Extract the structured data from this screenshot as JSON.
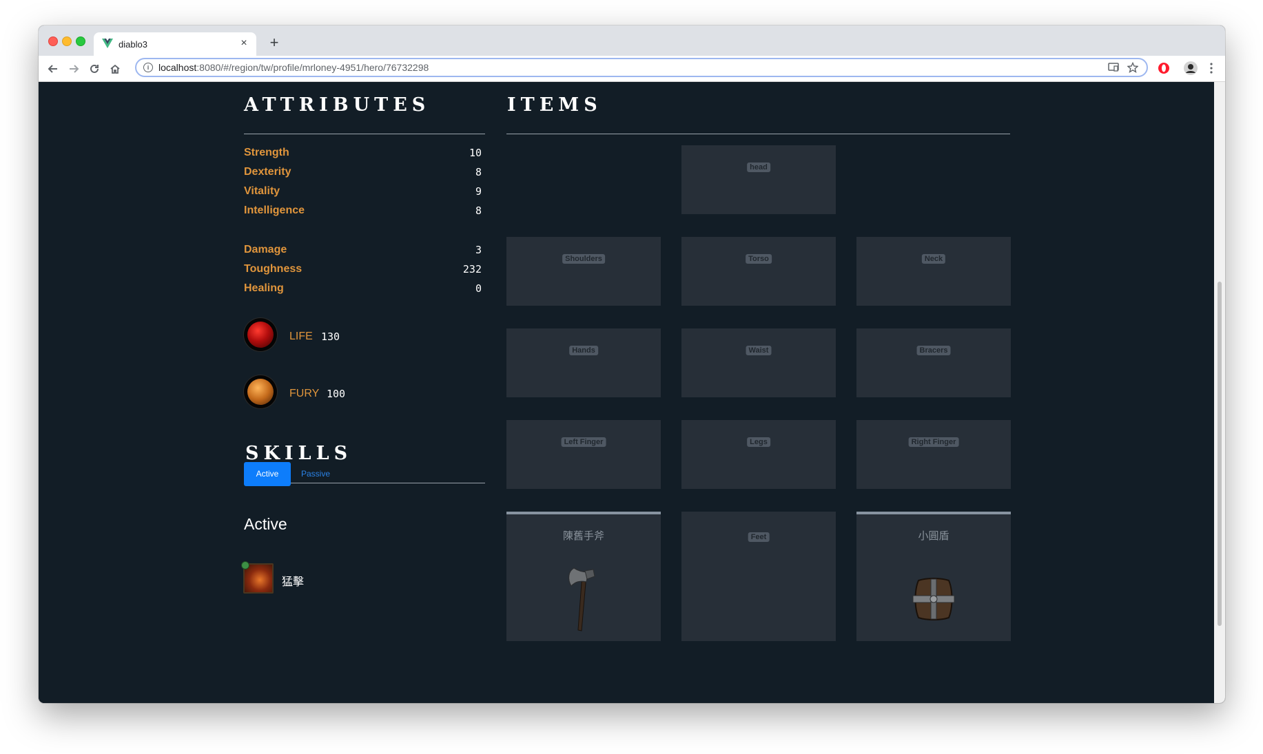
{
  "browser": {
    "tab_title": "diablo3",
    "tab_close": "×",
    "new_tab": "+",
    "url_host": "localhost",
    "url_rest": ":8080/#/region/tw/profile/mrloney-4951/hero/76732298"
  },
  "attributes": {
    "title": "ATTRIBUTES",
    "core": [
      {
        "label": "Strength",
        "value": "10"
      },
      {
        "label": "Dexterity",
        "value": "8"
      },
      {
        "label": "Vitality",
        "value": "9"
      },
      {
        "label": "Intelligence",
        "value": "8"
      }
    ],
    "secondary": [
      {
        "label": "Damage",
        "value": "3"
      },
      {
        "label": "Toughness",
        "value": "232"
      },
      {
        "label": "Healing",
        "value": "0"
      }
    ]
  },
  "resources": {
    "life": {
      "label": "LIFE",
      "value": "130"
    },
    "fury": {
      "label": "FURY",
      "value": "100"
    }
  },
  "skills": {
    "title": "SKILLS",
    "tabs": {
      "active": "Active",
      "passive": "Passive"
    },
    "section_title": "Active",
    "active_skills": [
      {
        "name": "猛擊"
      }
    ]
  },
  "items": {
    "title": "ITEMS",
    "slots": {
      "head": "head",
      "shoulders": "Shoulders",
      "torso": "Torso",
      "neck": "Neck",
      "hands": "Hands",
      "waist": "Waist",
      "bracers": "Bracers",
      "left_finger": "Left Finger",
      "legs": "Legs",
      "right_finger": "Right Finger",
      "main_hand": "陳舊手斧",
      "feet": "Feet",
      "off_hand": "小圓盾"
    }
  },
  "colors": {
    "page_bg": "#121d26",
    "slot_bg": "#272f38",
    "label_orange": "#e0953c",
    "active_button": "#0d7dfb"
  }
}
